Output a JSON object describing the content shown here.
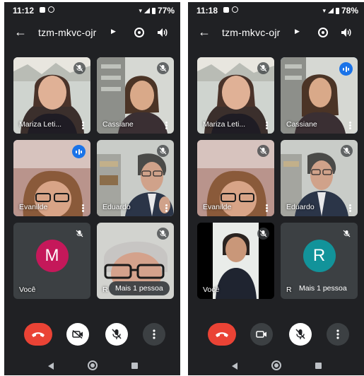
{
  "screens": [
    {
      "status": {
        "time": "11:12",
        "battery": "77%"
      },
      "meeting_code": "tzm-mkvc-ojr",
      "tiles": [
        {
          "name": "Mariza Leti...",
          "state": "muted"
        },
        {
          "name": "Cassiane",
          "state": "muted"
        },
        {
          "name": "Evanilde",
          "state": "speaking"
        },
        {
          "name": "Eduardo",
          "state": "muted"
        },
        {
          "name": "Você",
          "state": "muted",
          "avatar_letter": "M",
          "avatar_color": "#c5185a"
        },
        {
          "name": "R",
          "state": "muted"
        }
      ],
      "more_people": "Mais 1 pessoa"
    },
    {
      "status": {
        "time": "11:18",
        "battery": "78%"
      },
      "meeting_code": "tzm-mkvc-ojr",
      "tiles": [
        {
          "name": "Mariza Leti...",
          "state": "muted"
        },
        {
          "name": "Cassiane",
          "state": "speaking"
        },
        {
          "name": "Evanilde",
          "state": "muted"
        },
        {
          "name": "Eduardo",
          "state": "muted"
        },
        {
          "name": "Você",
          "state": "muted"
        },
        {
          "name": "R",
          "state": "muted",
          "avatar_letter": "R",
          "avatar_color": "#12939a"
        }
      ],
      "more_people": "Mais 1 pessoa"
    }
  ],
  "colors": {
    "end_call": "#ea4335",
    "speaking": "#1a73e8",
    "background": "#202124",
    "tile": "#3c4043"
  },
  "icons": [
    "back-arrow-icon",
    "chevron-right-icon",
    "switch-camera-icon",
    "speaker-icon",
    "end-call-icon",
    "camera-off-icon",
    "camera-icon",
    "mic-off-icon",
    "more-options-icon",
    "nav-back-icon",
    "nav-home-icon",
    "nav-recents-icon"
  ]
}
